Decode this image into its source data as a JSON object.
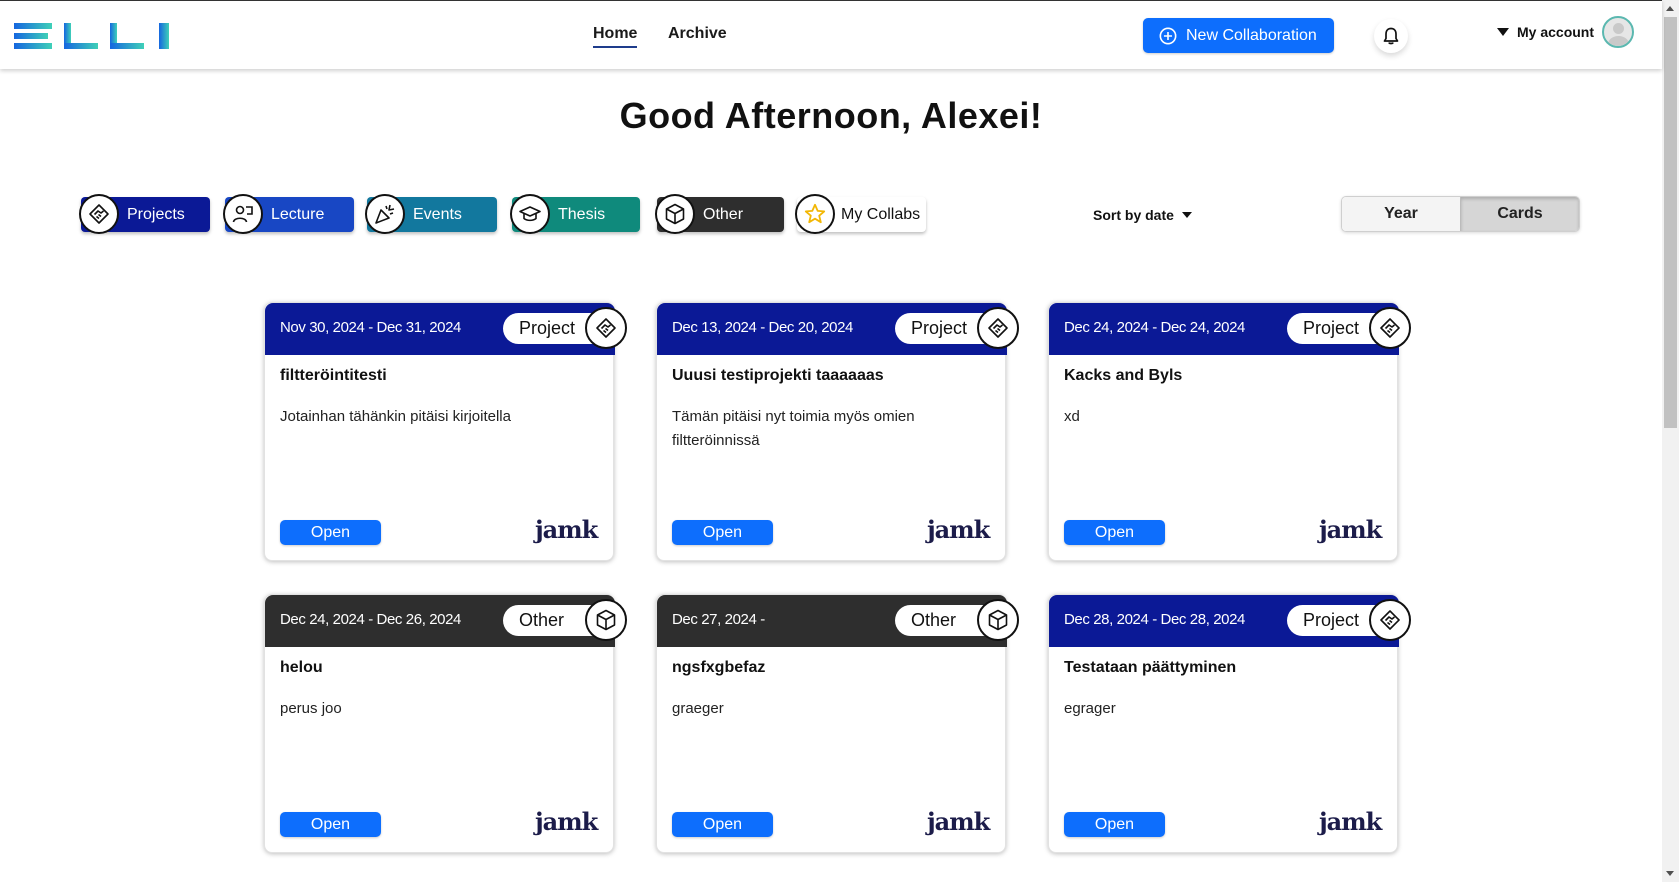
{
  "header": {
    "logo_text": "ELLI",
    "nav": {
      "home": "Home",
      "archive": "Archive"
    },
    "new_collab_label": "New Collaboration",
    "account_label": "My account",
    "brand_gradient": [
      "#1566e0",
      "#3fd0b8"
    ]
  },
  "greeting": "Good Afternoon, Alexei!",
  "filters": {
    "projects": "Projects",
    "lecture": "Lecture",
    "events": "Events",
    "thesis": "Thesis",
    "other": "Other",
    "my_collabs": "My Collabs"
  },
  "filter_colors": {
    "projects": "#0b1996",
    "lecture": "#1847c4",
    "events": "#12789e",
    "thesis": "#0f8a7c",
    "other": "#2e2e2e"
  },
  "sort_label": "Sort by date",
  "view_toggle": {
    "year": "Year",
    "cards": "Cards",
    "selected": "Cards"
  },
  "cards": [
    {
      "dates": "Nov 30, 2024 - Dec 31, 2024",
      "type": "Project",
      "icon": "handshake-icon",
      "title": "filtteröintitesti",
      "description": "Jotainhan tähänkin pitäisi kirjoitella",
      "open_label": "Open",
      "brand": "jamk"
    },
    {
      "dates": "Dec 13, 2024 - Dec 20, 2024",
      "type": "Project",
      "icon": "handshake-icon",
      "title": "Uuusi testiprojekti taaaaaas",
      "description": "Tämän pitäisi nyt toimia myös omien filtteröinnissä",
      "open_label": "Open",
      "brand": "jamk"
    },
    {
      "dates": "Dec 24, 2024 - Dec 24, 2024",
      "type": "Project",
      "icon": "handshake-icon",
      "title": "Kacks and Byls",
      "description": "xd",
      "open_label": "Open",
      "brand": "jamk"
    },
    {
      "dates": "Dec 24, 2024 - Dec 26, 2024",
      "type": "Other",
      "icon": "cube-icon",
      "title": "helou",
      "description": "perus joo",
      "open_label": "Open",
      "brand": "jamk"
    },
    {
      "dates": "Dec 27, 2024 -",
      "type": "Other",
      "icon": "cube-icon",
      "title": "ngsfxgbefaz",
      "description": "graeger",
      "open_label": "Open",
      "brand": "jamk"
    },
    {
      "dates": "Dec 28, 2024 - Dec 28, 2024",
      "type": "Project",
      "icon": "handshake-icon",
      "title": "Testataan päättyminen",
      "description": "egrager",
      "open_label": "Open",
      "brand": "jamk"
    }
  ]
}
